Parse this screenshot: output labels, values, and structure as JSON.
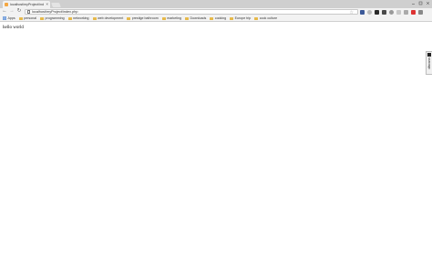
{
  "tab": {
    "title": "localhost/myProject/ind",
    "close_glyph": "×"
  },
  "toolbar": {
    "back_glyph": "←",
    "forward_glyph": "→",
    "reload_glyph": "↻",
    "url": "localhost/myProject/index.php",
    "star_glyph": "☆"
  },
  "bookmarks": [
    {
      "label": "Apps",
      "icon": "apps-icon"
    },
    {
      "label": "personal",
      "icon": "folder-icon"
    },
    {
      "label": "programming",
      "icon": "folder-icon"
    },
    {
      "label": "networking",
      "icon": "folder-icon"
    },
    {
      "label": "web development",
      "icon": "folder-icon"
    },
    {
      "label": "prestige bathroom",
      "icon": "folder-icon"
    },
    {
      "label": "marketing",
      "icon": "folder-icon"
    },
    {
      "label": "Downloads",
      "icon": "folder-icon"
    },
    {
      "label": "cooking",
      "icon": "folder-icon"
    },
    {
      "label": "Europe trip",
      "icon": "folder-icon"
    },
    {
      "label": "cook culture",
      "icon": "folder-icon"
    }
  ],
  "page": {
    "body_text": "hello world"
  },
  "sidebar_tab": {
    "label": "discuss"
  },
  "colors": {
    "tabstrip": "#cfcfcf",
    "toolbar": "#f2f2f2",
    "folder": "#e6b94a",
    "favicon": "#f4a742"
  }
}
